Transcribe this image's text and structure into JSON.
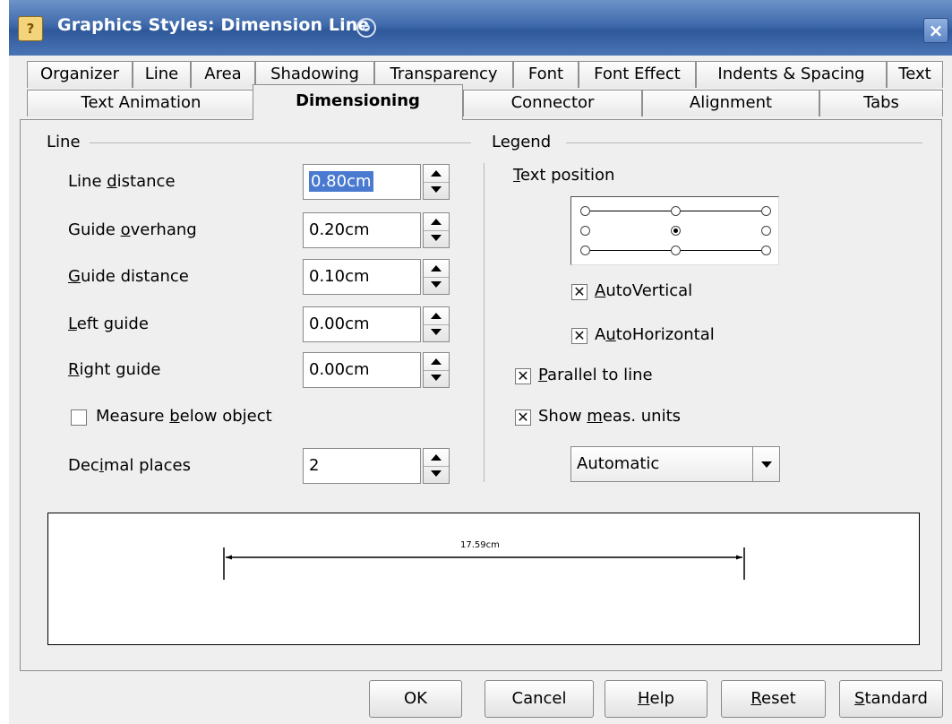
{
  "window": {
    "title": "Graphics Styles: Dimension Line",
    "close_glyph": "×",
    "app_icon_glyph": "?"
  },
  "tabs_row1": [
    "Organizer",
    "Line",
    "Area",
    "Shadowing",
    "Transparency",
    "Font",
    "Font Effect",
    "Indents & Spacing",
    "Text"
  ],
  "tabs_row2": [
    "Text Animation",
    "Dimensioning",
    "Connector",
    "Alignment",
    "Tabs"
  ],
  "active_tab": "Dimensioning",
  "line_group": {
    "label": "Line",
    "fields": [
      {
        "pre": "Line ",
        "key": "d",
        "post": "istance",
        "value": "0.80cm"
      },
      {
        "pre": "Guide ",
        "key": "o",
        "post": "verhang",
        "value": "0.20cm"
      },
      {
        "pre": "",
        "key": "G",
        "post": "uide distance",
        "value": "0.10cm"
      },
      {
        "pre": "",
        "key": "L",
        "post": "eft guide",
        "value": "0.00cm"
      },
      {
        "pre": "",
        "key": "R",
        "post": "ight guide",
        "value": "0.00cm"
      }
    ],
    "measure_below": {
      "pre": "Measure ",
      "key": "b",
      "post": "elow object",
      "checked": false
    },
    "decimal": {
      "pre": "Dec",
      "key": "i",
      "post": "mal places",
      "value": "2"
    }
  },
  "legend_group": {
    "label": "Legend",
    "text_position": {
      "pre": "",
      "key": "T",
      "post": "ext position",
      "selected": "middle-center"
    },
    "auto_vertical": {
      "pre": "",
      "key": "A",
      "post": "utoVertical",
      "checked": true
    },
    "auto_horizontal": {
      "pre": "A",
      "key": "u",
      "post": "toHorizontal",
      "checked": true
    },
    "parallel": {
      "pre": "",
      "key": "P",
      "post": "arallel to line",
      "checked": true
    },
    "show_units": {
      "pre": "Show ",
      "key": "m",
      "post": "eas. units",
      "checked": true
    },
    "unit_select": "Automatic",
    "check_glyph": "✕"
  },
  "preview": {
    "measure_text": "17.59cm"
  },
  "buttons": {
    "ok": {
      "pre": "OK",
      "key": "",
      "post": ""
    },
    "cancel": {
      "pre": "Cancel",
      "key": "",
      "post": ""
    },
    "help": {
      "pre": "",
      "key": "H",
      "post": "elp"
    },
    "reset": {
      "pre": "",
      "key": "R",
      "post": "eset"
    },
    "standard": {
      "pre": "",
      "key": "S",
      "post": "tandard"
    }
  },
  "colors": {
    "title_bar": "#3f6aab",
    "selection": "#4a7ad0",
    "dialog_bg": "#efefef"
  }
}
